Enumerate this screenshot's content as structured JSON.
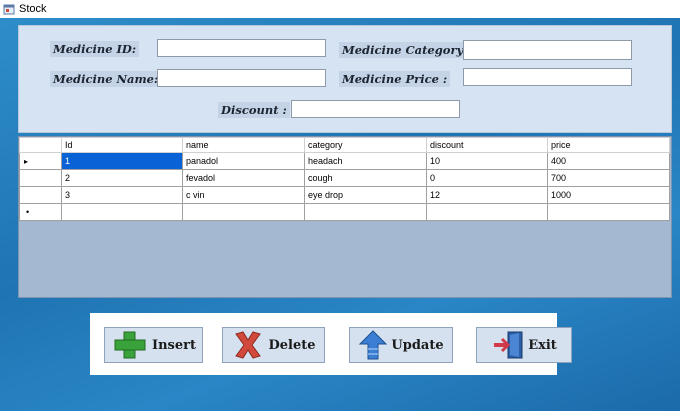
{
  "window": {
    "title": "Stock"
  },
  "form": {
    "medicine_id_label": "Medicine ID:",
    "medicine_id_value": "",
    "medicine_category_label": "Medicine Category:",
    "medicine_category_value": "",
    "medicine_name_label": "Medicine Name:",
    "medicine_name_value": "",
    "medicine_price_label": "Medicine Price :",
    "medicine_price_value": "",
    "discount_label": "Discount :",
    "discount_value": ""
  },
  "grid": {
    "columns": [
      "Id",
      "name",
      "category",
      "discount",
      "price"
    ],
    "rows": [
      {
        "indicator": "▸",
        "cells": [
          "1",
          "panadol",
          "headach",
          "10",
          "400"
        ]
      },
      {
        "indicator": "",
        "cells": [
          "2",
          "fevadol",
          "cough",
          "0",
          "700"
        ]
      },
      {
        "indicator": "",
        "cells": [
          "3",
          "c vin",
          "eye drop",
          "12",
          "1000"
        ]
      },
      {
        "indicator": "•",
        "cells": [
          "",
          "",
          "",
          "",
          ""
        ]
      }
    ],
    "selected_cell": {
      "row": 0,
      "column": 0
    }
  },
  "buttons": {
    "insert": "Insert",
    "delete": "Delete",
    "update": "Update",
    "exit": "Exit"
  },
  "icons": {
    "window": "app-window-icon",
    "insert": "plus-icon",
    "delete": "x-icon",
    "update": "up-arrow-icon",
    "exit": "door-exit-icon"
  },
  "colors": {
    "selection": "#0a63d6",
    "insert_icon": "#3aa23a",
    "delete_icon": "#d24a3c",
    "update_icon": "#3b7fd4"
  }
}
